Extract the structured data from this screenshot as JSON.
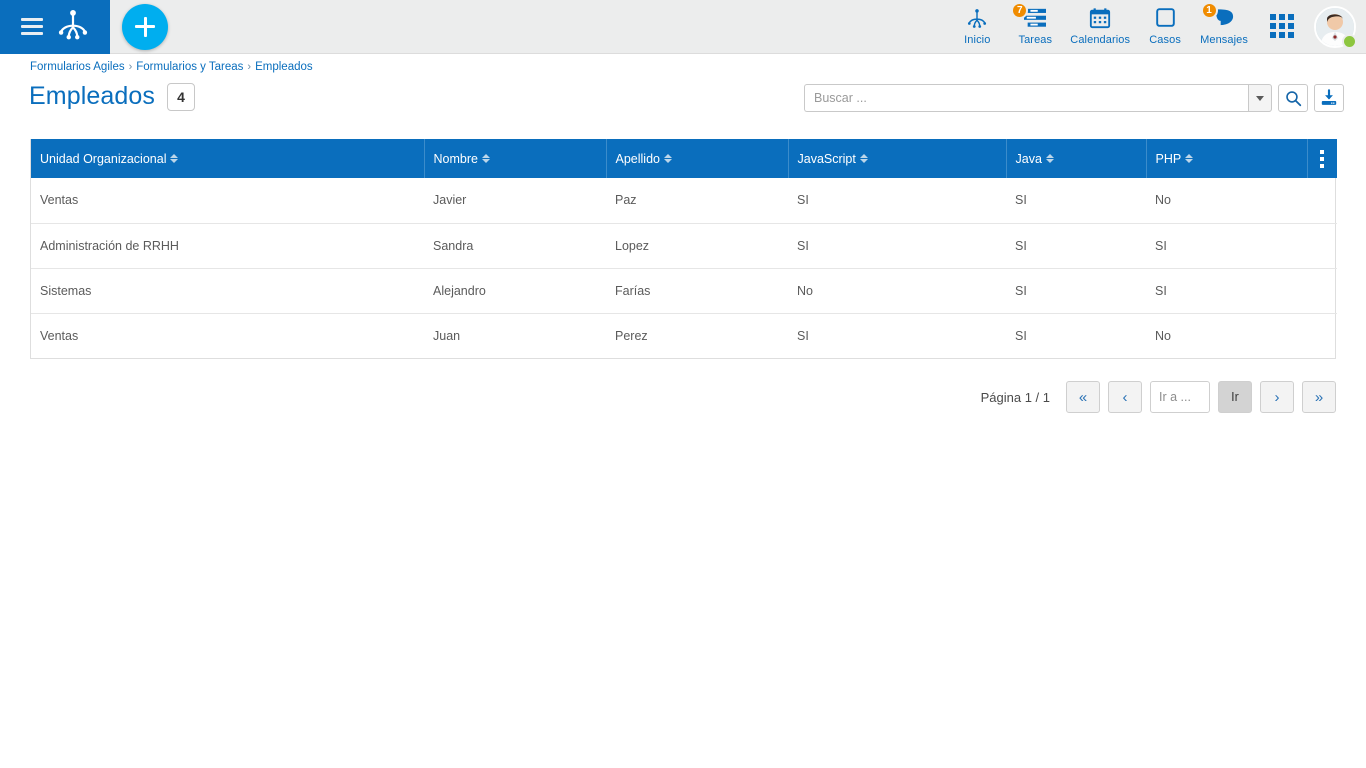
{
  "topbar": {
    "menu_label": "menu",
    "logo_label": "Deyel",
    "add_label": "+",
    "nav": [
      {
        "label": "Inicio",
        "icon": "home-frog-icon",
        "badge": null
      },
      {
        "label": "Tareas",
        "icon": "tasks-list-icon",
        "badge": "7"
      },
      {
        "label": "Calendarios",
        "icon": "calendar-icon",
        "badge": null
      },
      {
        "label": "Casos",
        "icon": "cases-square-icon",
        "badge": null
      },
      {
        "label": "Mensajes",
        "icon": "messages-bubble-icon",
        "badge": "1"
      }
    ],
    "apps_label": "apps-grid",
    "avatar_label": "user-avatar",
    "status": "online"
  },
  "breadcrumb": {
    "items": [
      "Formularios Agiles",
      "Formularios y Tareas",
      "Empleados"
    ],
    "separator": "›"
  },
  "page": {
    "title": "Empleados",
    "count": "4"
  },
  "search": {
    "placeholder": "Buscar ...",
    "value": "",
    "dropdown_label": "opciones",
    "search_label": "buscar",
    "export_label": "exportar"
  },
  "table": {
    "columns": [
      "Unidad Organizacional",
      "Nombre",
      "Apellido",
      "JavaScript",
      "Java",
      "PHP"
    ],
    "rows": [
      {
        "unidad": "Ventas",
        "nombre": "Javier",
        "apellido": "Paz",
        "javascript": "SI",
        "java": "SI",
        "php": "No"
      },
      {
        "unidad": "Administración de RRHH",
        "nombre": "Sandra",
        "apellido": "Lopez",
        "javascript": "SI",
        "java": "SI",
        "php": "SI"
      },
      {
        "unidad": "Sistemas",
        "nombre": "Alejandro",
        "apellido": "Farías",
        "javascript": "No",
        "java": "SI",
        "php": "SI"
      },
      {
        "unidad": "Ventas",
        "nombre": "Juan",
        "apellido": "Perez",
        "javascript": "SI",
        "java": "SI",
        "php": "No"
      }
    ],
    "menu_label": "opciones de columna"
  },
  "pagination": {
    "page_label": "Página 1 / 1",
    "first": "«",
    "prev": "‹",
    "goto_placeholder": "Ir a ...",
    "goto_value": "",
    "go": "Ir",
    "next": "›",
    "last": "»"
  },
  "colors": {
    "brand_blue": "#0a6ebd",
    "accent_cyan": "#00aeef",
    "badge_orange": "#f08c00",
    "status_green": "#8dc63f",
    "topbar_gray": "#eceded"
  }
}
